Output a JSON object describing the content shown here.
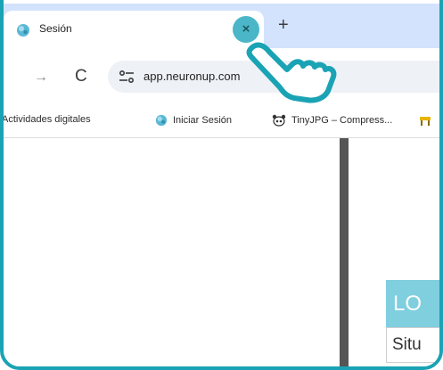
{
  "tab": {
    "title": "Sesión",
    "close_glyph": "×",
    "new_tab_glyph": "+"
  },
  "nav": {
    "forward_glyph": "→",
    "reload_glyph": "C",
    "url": "app.neuronup.com"
  },
  "bookmarks": [
    {
      "label": "Actividades digitales",
      "icon": "none"
    },
    {
      "label": "Iniciar Sesión",
      "icon": "neuronup-favicon"
    },
    {
      "label": "TinyJPG – Compress...",
      "icon": "tinyjpg-panda-icon"
    },
    {
      "label": "",
      "icon": "yellow-favicon"
    }
  ],
  "page": {
    "banner_text": "LO",
    "sub_text": "Situ"
  },
  "colors": {
    "frame": "#1aa3b4",
    "tab_strip": "#d3e3fd",
    "close_highlight": "#4ab6c8",
    "banner": "#7fcfdf",
    "divider": "#555555"
  }
}
